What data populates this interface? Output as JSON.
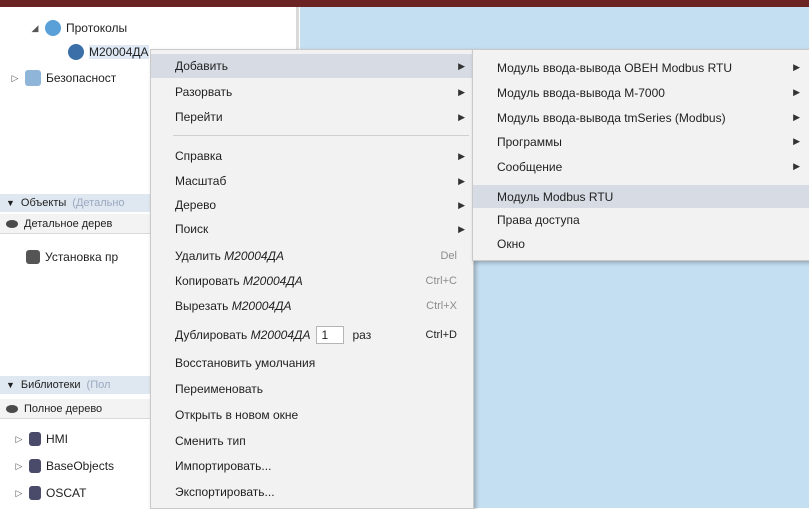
{
  "tree": {
    "protocols_label": "Протоколы",
    "device_label": "М20004ДА",
    "security_label": "Безопасност"
  },
  "objects_panel": {
    "title": "Объекты",
    "title_suffix": "(Детально",
    "view_label": "Детальное дерев",
    "item_label": "Установка пр"
  },
  "libraries_panel": {
    "title": "Библиотеки",
    "title_suffix": "(Пол",
    "view_label": "Полное дерево",
    "items": [
      "HMI",
      "BaseObjects",
      "OSCAT"
    ]
  },
  "context_menu": {
    "add": "Добавить",
    "unlink": "Разорвать",
    "goto": "Перейти",
    "help": "Справка",
    "scale": "Масштаб",
    "tree": "Дерево",
    "search": "Поиск",
    "delete_prefix": "Удалить",
    "delete_obj": "М20004ДА",
    "delete_sc": "Del",
    "copy_prefix": "Копировать",
    "copy_obj": "М20004ДА",
    "copy_sc": "Ctrl+C",
    "cut_prefix": "Вырезать",
    "cut_obj": "М20004ДА",
    "cut_sc": "Ctrl+X",
    "dup_prefix": "Дублировать",
    "dup_obj": "М20004ДА",
    "dup_count": "1",
    "dup_suffix": "раз",
    "dup_sc": "Ctrl+D",
    "restore": "Восстановить умолчания",
    "rename": "Переименовать",
    "open_new": "Открыть в новом окне",
    "change_type": "Сменить тип",
    "import": "Импортировать...",
    "export": "Экспортировать..."
  },
  "submenu": {
    "items": [
      "Модуль ввода-вывода ОВЕН Modbus RTU",
      "Модуль ввода-вывода М-7000",
      "Модуль ввода-вывода tmSeries (Modbus)",
      "Программы",
      "Сообщение",
      "Модуль Modbus RTU",
      "Права доступа",
      "Окно"
    ]
  },
  "colors": {
    "title_bar": "#6b2324",
    "canvas_bg": "#c4dff2",
    "highlight": "#d6dbe4"
  }
}
